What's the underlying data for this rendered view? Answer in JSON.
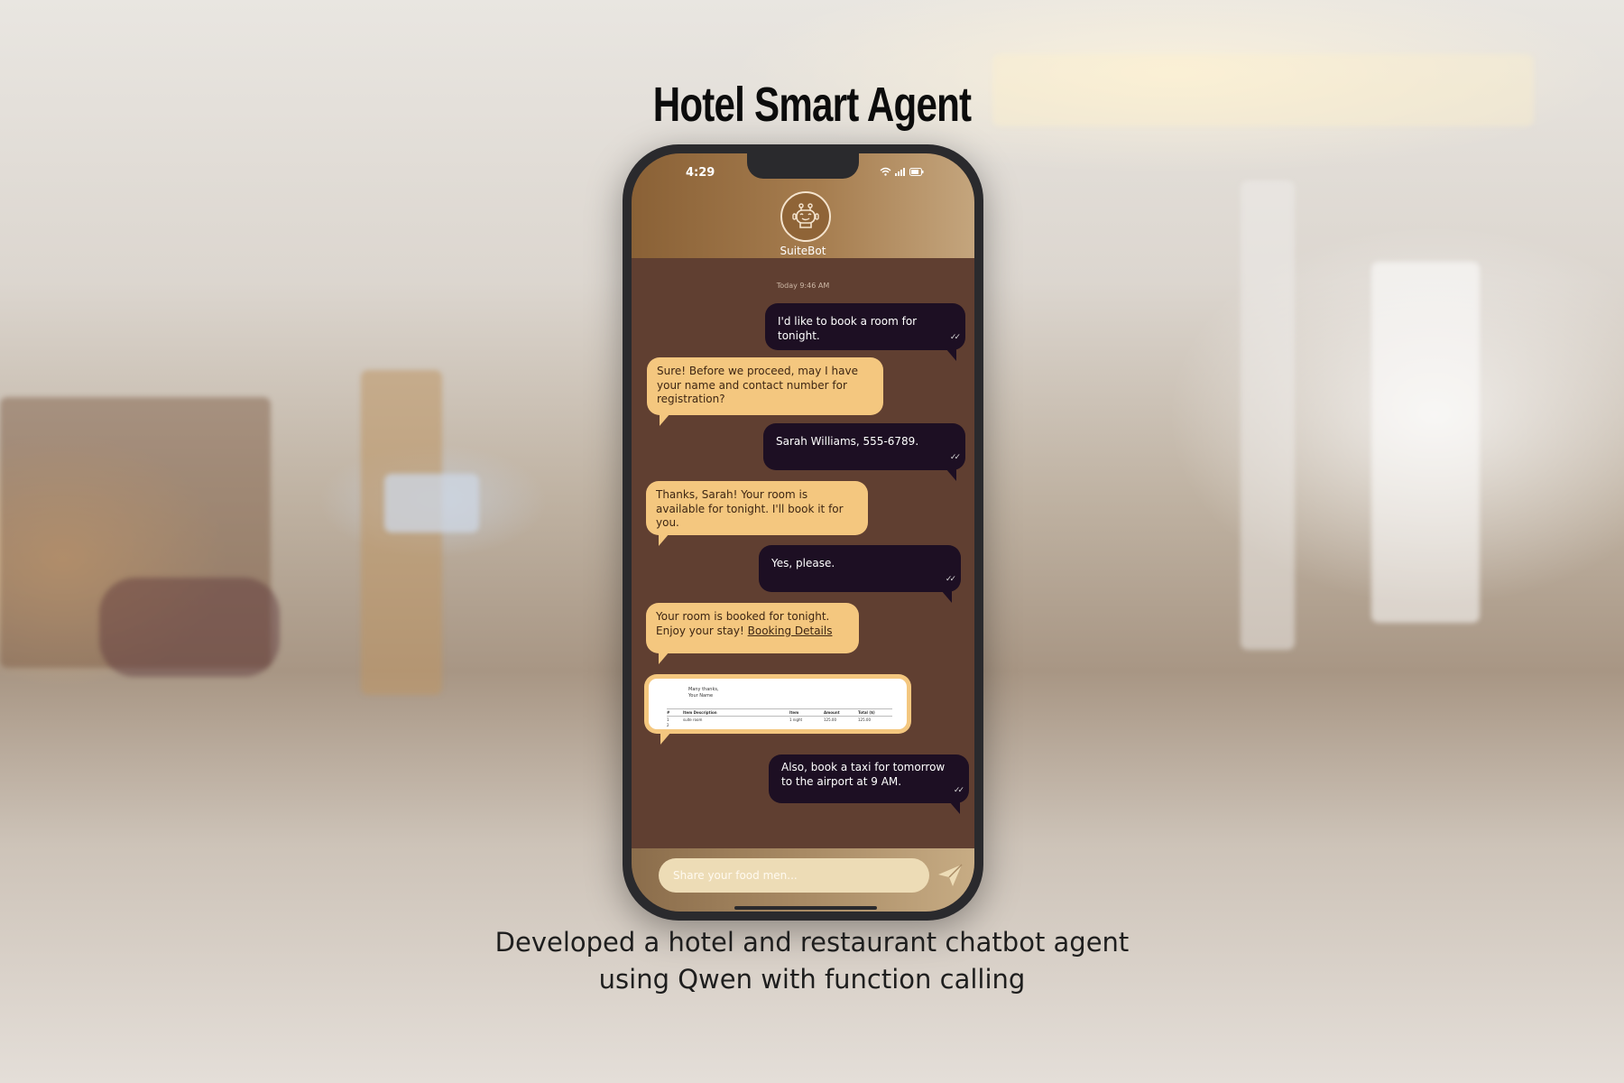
{
  "page": {
    "title": "Hotel Smart Agent",
    "caption_line1": "Developed a hotel and restaurant chatbot agent",
    "caption_line2": "using Qwen with function calling"
  },
  "phone": {
    "status_time": "4:29",
    "bot_name": "SuiteBot",
    "timestamp": "Today 9:46 AM",
    "messages": [
      {
        "from": "user",
        "text": "I'd like to book a room for tonight."
      },
      {
        "from": "bot",
        "text": "Sure! Before we proceed, may I have your name and contact number for registration?"
      },
      {
        "from": "user",
        "text": "Sarah Williams, 555-6789."
      },
      {
        "from": "bot",
        "text": "Thanks, Sarah! Your room is available for tonight. I'll book it for you."
      },
      {
        "from": "user",
        "text": "Yes, please."
      },
      {
        "from": "bot",
        "text": "Your room is booked for tonight. Enjoy your stay!",
        "link": "Booking Details"
      },
      {
        "from": "user",
        "text": "Also, book a taxi for tomorrow to the airport at 9 AM."
      }
    ],
    "invoice": {
      "note_line1": "Many thanks,",
      "note_line2": "Your Name",
      "headers": [
        "#",
        "Item Description",
        "Item",
        "Amount",
        "Total ($)"
      ],
      "rows": [
        [
          "1",
          "suite room",
          "1 night",
          "125.00",
          "125.00"
        ],
        [
          "2",
          "",
          "",
          "",
          ""
        ]
      ]
    },
    "composer_placeholder": "Share your food men...",
    "accent_user": "#1d0f23",
    "accent_bot": "#f4c77f",
    "chat_background": "#603f31"
  }
}
